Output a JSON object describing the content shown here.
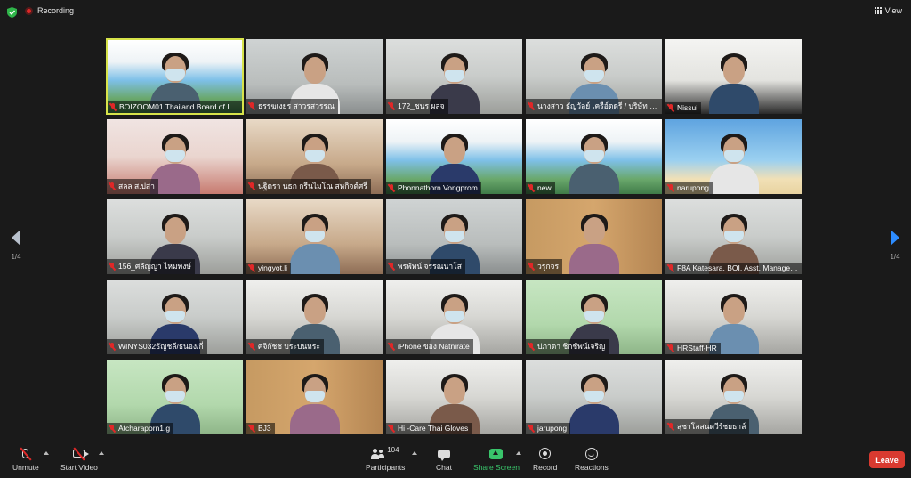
{
  "topbar": {
    "recording_label": "Recording",
    "view_label": "View"
  },
  "pagination": {
    "left_page": "1/4",
    "right_page": "1/4"
  },
  "participants": [
    {
      "name": "BOIZOOM01 Thailand Board of Invest...",
      "active": true,
      "bg": "boi"
    },
    {
      "name": "ธรรฆเงยร สาวรสวรรณ",
      "active": false,
      "bg": "room"
    },
    {
      "name": "172_ชนร  ผลจ",
      "active": false,
      "bg": "office"
    },
    {
      "name": "นางสาว ธัญวัลย์ เครือ์ดดรี / บริษัท เดอ...",
      "active": false,
      "bg": "office"
    },
    {
      "name": "Nissui",
      "active": false,
      "bg": "boardroom"
    },
    {
      "name": "สลล ส.ปสา",
      "active": false,
      "bg": "pinkroom"
    },
    {
      "name": "นฐิดรา นธก กรีนไมโณ สหกิจต์ศรึ่",
      "active": false,
      "bg": "warm"
    },
    {
      "name": "Phonnathorn Vongprom",
      "active": false,
      "bg": "boi"
    },
    {
      "name": "new",
      "active": false,
      "bg": "boi"
    },
    {
      "name": "narupong",
      "active": false,
      "bg": "beach"
    },
    {
      "name": "156_ศลัญญา ไหมพงษ์",
      "active": false,
      "bg": "office"
    },
    {
      "name": "yingyot.li",
      "active": false,
      "bg": "warm"
    },
    {
      "name": "พรพัทน์ จรรณนาโส",
      "active": false,
      "bg": "room"
    },
    {
      "name": "วรุกจร",
      "active": false,
      "bg": "shelf"
    },
    {
      "name": "F8A Katesara, BOI, Asst. Manager, ...",
      "active": false,
      "bg": "office"
    },
    {
      "name": "WINYS032ธัญชลี/ธนอง/กี่",
      "active": false,
      "bg": "office"
    },
    {
      "name": "ศจิกัชช บระบนหระ",
      "active": false,
      "bg": "ceiling"
    },
    {
      "name": "iPhone ของ Natnirate",
      "active": false,
      "bg": "ceiling"
    },
    {
      "name": "ปภาดา ชิกชัพน์เจริญ",
      "active": false,
      "bg": "green"
    },
    {
      "name": "HRStaff-HR",
      "active": false,
      "bg": "ceiling"
    },
    {
      "name": "Atcharaporn1.g",
      "active": false,
      "bg": "green"
    },
    {
      "name": "BJ3",
      "active": false,
      "bg": "shelf"
    },
    {
      "name": "Hi -Care Thai Gloves",
      "active": false,
      "bg": "ceiling"
    },
    {
      "name": "jarupong",
      "active": false,
      "bg": "office"
    },
    {
      "name": "สุชาโลสนดวีร์ชยธาล์",
      "active": false,
      "bg": "ceiling"
    }
  ],
  "toolbar": {
    "unmute_label": "Unmute",
    "start_video_label": "Start Video",
    "participants_label": "Participants",
    "participants_count": "104",
    "chat_label": "Chat",
    "share_screen_label": "Share Screen",
    "record_label": "Record",
    "reactions_label": "Reactions",
    "leave_label": "Leave"
  },
  "colors": {
    "background": "#1a1a1a",
    "active_speaker_border": "#d7e34a",
    "share_green": "#39c56b",
    "leave_red": "#d93a30",
    "mic_off_red": "#e02828",
    "next_arrow_blue": "#2d8cff"
  }
}
